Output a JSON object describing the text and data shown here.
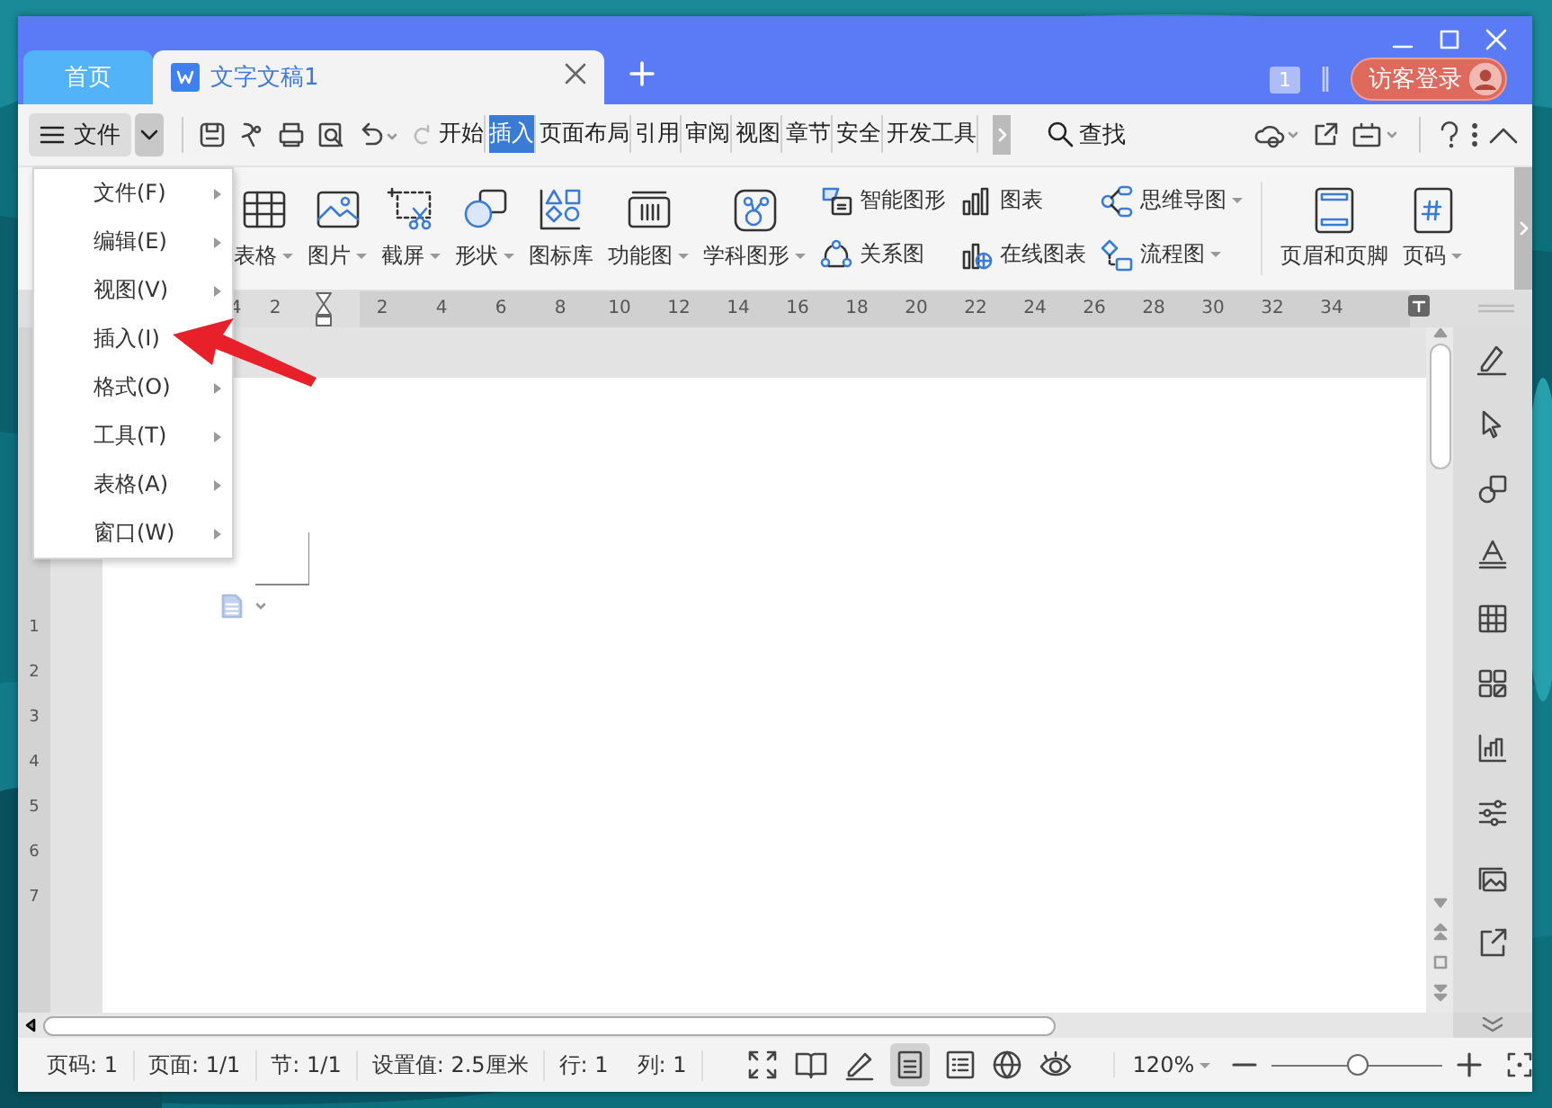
{
  "title_bar": {
    "tabs": [
      {
        "label": "首页",
        "selected": false
      },
      {
        "label": "文字文稿1",
        "selected": true,
        "closable": true
      }
    ],
    "badge": "1",
    "login_button": "访客登录"
  },
  "toolbar": {
    "file_menu": "文件",
    "tabs": [
      {
        "label": "开始",
        "selected": false
      },
      {
        "label": "插入",
        "selected": true
      },
      {
        "label": "页面布局",
        "selected": false
      },
      {
        "label": "引用",
        "selected": false
      },
      {
        "label": "审阅",
        "selected": false
      },
      {
        "label": "视图",
        "selected": false
      },
      {
        "label": "章节",
        "selected": false
      },
      {
        "label": "安全",
        "selected": false
      },
      {
        "label": "开发工具",
        "selected": false
      }
    ],
    "search": "查找"
  },
  "ribbon": {
    "large_buttons": [
      {
        "label": "表格",
        "dropdown": true
      },
      {
        "label": "图片",
        "dropdown": true
      },
      {
        "label": "截屏",
        "dropdown": true
      },
      {
        "label": "形状",
        "dropdown": true
      },
      {
        "label": "图标库",
        "dropdown": false
      },
      {
        "label": "功能图",
        "dropdown": true
      },
      {
        "label": "学科图形",
        "dropdown": true
      }
    ],
    "small_buttons": [
      {
        "label": "智能图形",
        "dropdown": false
      },
      {
        "label": "关系图",
        "dropdown": false
      },
      {
        "label": "图表",
        "dropdown": false
      },
      {
        "label": "在线图表",
        "dropdown": false
      },
      {
        "label": "思维导图",
        "dropdown": true
      },
      {
        "label": "流程图",
        "dropdown": true
      }
    ],
    "right_buttons": [
      {
        "label": "页眉和页脚",
        "dropdown": false
      },
      {
        "label": "页码",
        "dropdown": true
      }
    ]
  },
  "ruler": {
    "numbers": [
      "4",
      "2",
      "2",
      "4",
      "6",
      "8",
      "10",
      "12",
      "14",
      "16",
      "18",
      "20",
      "22",
      "24",
      "26",
      "28",
      "30",
      "32",
      "34"
    ],
    "vertical_numbers": [
      "1",
      "2",
      "3",
      "4",
      "5",
      "6",
      "7"
    ]
  },
  "menu": {
    "items": [
      {
        "label": "文件(F)",
        "submenu": true
      },
      {
        "label": "编辑(E)",
        "submenu": true
      },
      {
        "label": "视图(V)",
        "submenu": true
      },
      {
        "label": "插入(I)",
        "submenu": false
      },
      {
        "label": "格式(O)",
        "submenu": true
      },
      {
        "label": "工具(T)",
        "submenu": true
      },
      {
        "label": "表格(A)",
        "submenu": true
      },
      {
        "label": "窗口(W)",
        "submenu": true
      }
    ]
  },
  "status_bar": {
    "fields": [
      "页码: 1",
      "页面: 1/1",
      "节: 1/1",
      "设置值: 2.5厘米",
      "行: 1",
      "列: 1"
    ],
    "zoom": "120%",
    "zoom_slider": {
      "level": 0.5
    }
  }
}
